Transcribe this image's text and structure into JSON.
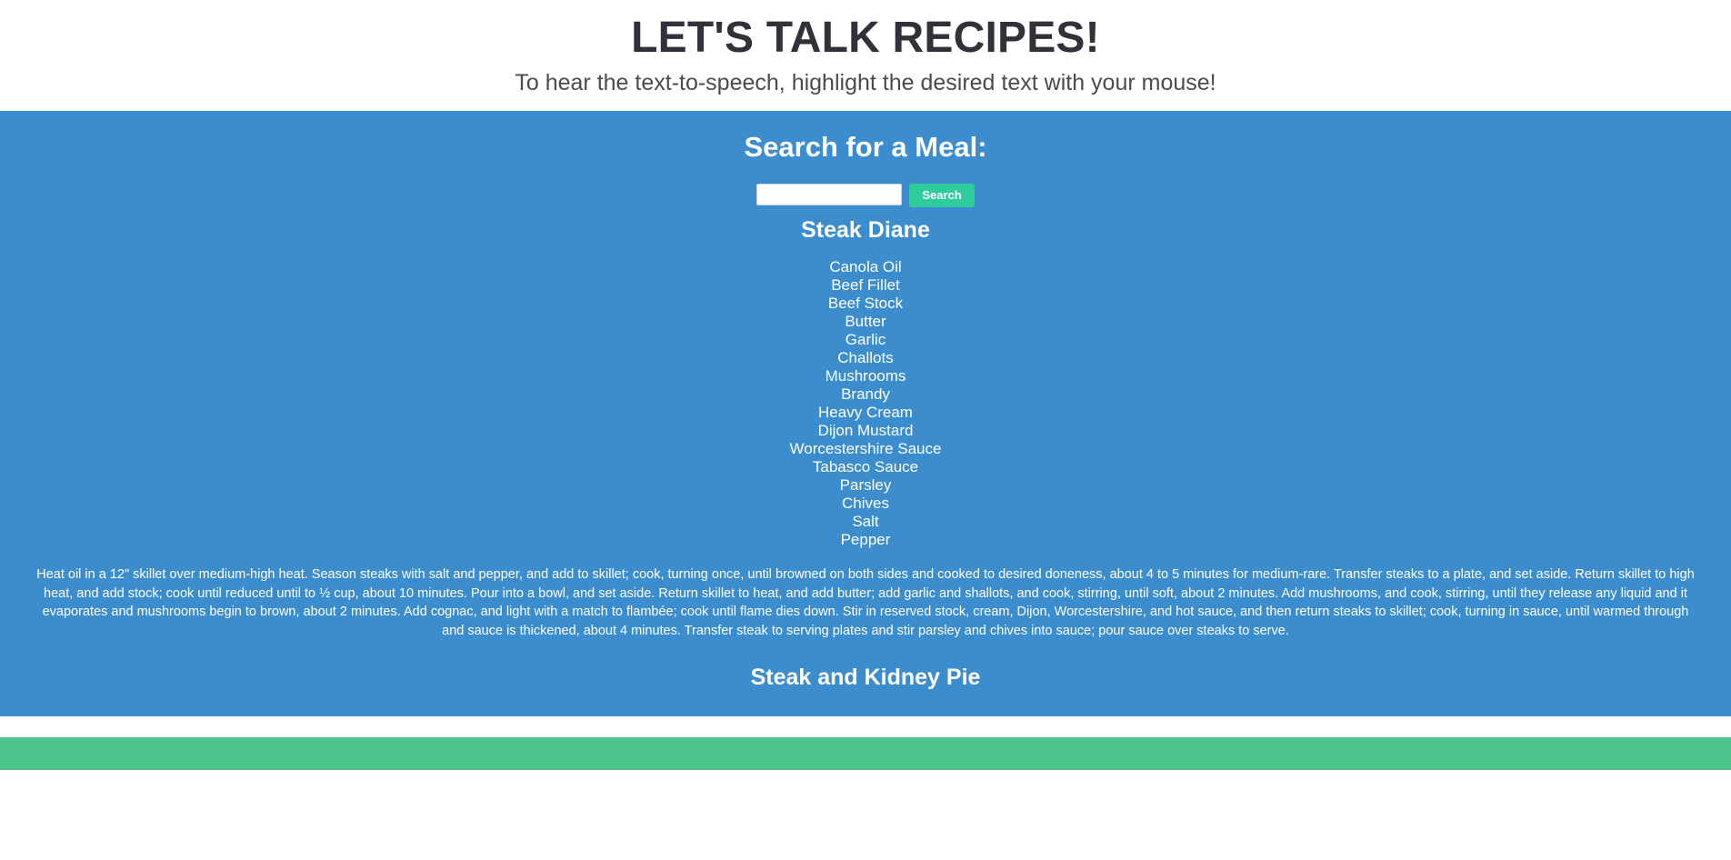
{
  "header": {
    "title": "LET'S TALK RECIPES!",
    "subtitle": "To hear the text-to-speech, highlight the desired text with your mouse!"
  },
  "search": {
    "heading": "Search for a Meal:",
    "input_value": "",
    "placeholder": "",
    "button_label": "Search"
  },
  "recipes": [
    {
      "name": "Steak Diane",
      "ingredients": [
        "Canola Oil",
        "Beef Fillet",
        "Beef Stock",
        "Butter",
        "Garlic",
        "Challots",
        "Mushrooms",
        "Brandy",
        "Heavy Cream",
        "Dijon Mustard",
        "Worcestershire Sauce",
        "Tabasco Sauce",
        "Parsley",
        "Chives",
        "Salt",
        "Pepper"
      ],
      "instructions": "Heat oil in a 12\" skillet over medium-high heat. Season steaks with salt and pepper, and add to skillet; cook, turning once, until browned on both sides and cooked to desired doneness, about 4 to 5 minutes for medium-rare. Transfer steaks to a plate, and set aside. Return skillet to high heat, and add stock; cook until reduced until to ½ cup, about 10 minutes. Pour into a bowl, and set aside. Return skillet to heat, and add butter; add garlic and shallots, and cook, stirring, until soft, about 2 minutes. Add mushrooms, and cook, stirring, until they release any liquid and it evaporates and mushrooms begin to brown, about 2 minutes. Add cognac, and light with a match to flambée; cook until flame dies down. Stir in reserved stock, cream, Dijon, Worcestershire, and hot sauce, and then return steaks to skillet; cook, turning in sauce, until warmed through and sauce is thickened, about 4 minutes. Transfer steak to serving plates and stir parsley and chives into sauce; pour sauce over steaks to serve."
    },
    {
      "name": "Steak and Kidney Pie",
      "ingredients": [],
      "instructions": ""
    }
  ],
  "colors": {
    "panel_blue": "#3c8dcd",
    "button_green": "#2ecc9b",
    "footer_green": "#4cc38a",
    "title_dark": "#32313a",
    "white": "#ffffff"
  }
}
